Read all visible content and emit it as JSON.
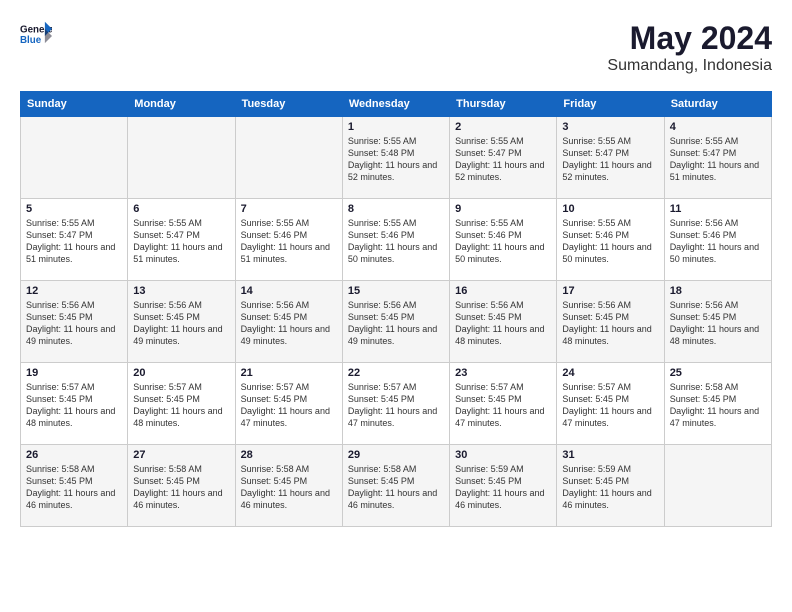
{
  "header": {
    "logo_general": "General",
    "logo_blue": "Blue",
    "month": "May 2024",
    "location": "Sumandang, Indonesia"
  },
  "days_of_week": [
    "Sunday",
    "Monday",
    "Tuesday",
    "Wednesday",
    "Thursday",
    "Friday",
    "Saturday"
  ],
  "weeks": [
    [
      {
        "day": "",
        "info": ""
      },
      {
        "day": "",
        "info": ""
      },
      {
        "day": "",
        "info": ""
      },
      {
        "day": "1",
        "info": "Sunrise: 5:55 AM\nSunset: 5:48 PM\nDaylight: 11 hours and 52 minutes."
      },
      {
        "day": "2",
        "info": "Sunrise: 5:55 AM\nSunset: 5:47 PM\nDaylight: 11 hours and 52 minutes."
      },
      {
        "day": "3",
        "info": "Sunrise: 5:55 AM\nSunset: 5:47 PM\nDaylight: 11 hours and 52 minutes."
      },
      {
        "day": "4",
        "info": "Sunrise: 5:55 AM\nSunset: 5:47 PM\nDaylight: 11 hours and 51 minutes."
      }
    ],
    [
      {
        "day": "5",
        "info": "Sunrise: 5:55 AM\nSunset: 5:47 PM\nDaylight: 11 hours and 51 minutes."
      },
      {
        "day": "6",
        "info": "Sunrise: 5:55 AM\nSunset: 5:47 PM\nDaylight: 11 hours and 51 minutes."
      },
      {
        "day": "7",
        "info": "Sunrise: 5:55 AM\nSunset: 5:46 PM\nDaylight: 11 hours and 51 minutes."
      },
      {
        "day": "8",
        "info": "Sunrise: 5:55 AM\nSunset: 5:46 PM\nDaylight: 11 hours and 50 minutes."
      },
      {
        "day": "9",
        "info": "Sunrise: 5:55 AM\nSunset: 5:46 PM\nDaylight: 11 hours and 50 minutes."
      },
      {
        "day": "10",
        "info": "Sunrise: 5:55 AM\nSunset: 5:46 PM\nDaylight: 11 hours and 50 minutes."
      },
      {
        "day": "11",
        "info": "Sunrise: 5:56 AM\nSunset: 5:46 PM\nDaylight: 11 hours and 50 minutes."
      }
    ],
    [
      {
        "day": "12",
        "info": "Sunrise: 5:56 AM\nSunset: 5:45 PM\nDaylight: 11 hours and 49 minutes."
      },
      {
        "day": "13",
        "info": "Sunrise: 5:56 AM\nSunset: 5:45 PM\nDaylight: 11 hours and 49 minutes."
      },
      {
        "day": "14",
        "info": "Sunrise: 5:56 AM\nSunset: 5:45 PM\nDaylight: 11 hours and 49 minutes."
      },
      {
        "day": "15",
        "info": "Sunrise: 5:56 AM\nSunset: 5:45 PM\nDaylight: 11 hours and 49 minutes."
      },
      {
        "day": "16",
        "info": "Sunrise: 5:56 AM\nSunset: 5:45 PM\nDaylight: 11 hours and 48 minutes."
      },
      {
        "day": "17",
        "info": "Sunrise: 5:56 AM\nSunset: 5:45 PM\nDaylight: 11 hours and 48 minutes."
      },
      {
        "day": "18",
        "info": "Sunrise: 5:56 AM\nSunset: 5:45 PM\nDaylight: 11 hours and 48 minutes."
      }
    ],
    [
      {
        "day": "19",
        "info": "Sunrise: 5:57 AM\nSunset: 5:45 PM\nDaylight: 11 hours and 48 minutes."
      },
      {
        "day": "20",
        "info": "Sunrise: 5:57 AM\nSunset: 5:45 PM\nDaylight: 11 hours and 48 minutes."
      },
      {
        "day": "21",
        "info": "Sunrise: 5:57 AM\nSunset: 5:45 PM\nDaylight: 11 hours and 47 minutes."
      },
      {
        "day": "22",
        "info": "Sunrise: 5:57 AM\nSunset: 5:45 PM\nDaylight: 11 hours and 47 minutes."
      },
      {
        "day": "23",
        "info": "Sunrise: 5:57 AM\nSunset: 5:45 PM\nDaylight: 11 hours and 47 minutes."
      },
      {
        "day": "24",
        "info": "Sunrise: 5:57 AM\nSunset: 5:45 PM\nDaylight: 11 hours and 47 minutes."
      },
      {
        "day": "25",
        "info": "Sunrise: 5:58 AM\nSunset: 5:45 PM\nDaylight: 11 hours and 47 minutes."
      }
    ],
    [
      {
        "day": "26",
        "info": "Sunrise: 5:58 AM\nSunset: 5:45 PM\nDaylight: 11 hours and 46 minutes."
      },
      {
        "day": "27",
        "info": "Sunrise: 5:58 AM\nSunset: 5:45 PM\nDaylight: 11 hours and 46 minutes."
      },
      {
        "day": "28",
        "info": "Sunrise: 5:58 AM\nSunset: 5:45 PM\nDaylight: 11 hours and 46 minutes."
      },
      {
        "day": "29",
        "info": "Sunrise: 5:58 AM\nSunset: 5:45 PM\nDaylight: 11 hours and 46 minutes."
      },
      {
        "day": "30",
        "info": "Sunrise: 5:59 AM\nSunset: 5:45 PM\nDaylight: 11 hours and 46 minutes."
      },
      {
        "day": "31",
        "info": "Sunrise: 5:59 AM\nSunset: 5:45 PM\nDaylight: 11 hours and 46 minutes."
      },
      {
        "day": "",
        "info": ""
      }
    ]
  ]
}
